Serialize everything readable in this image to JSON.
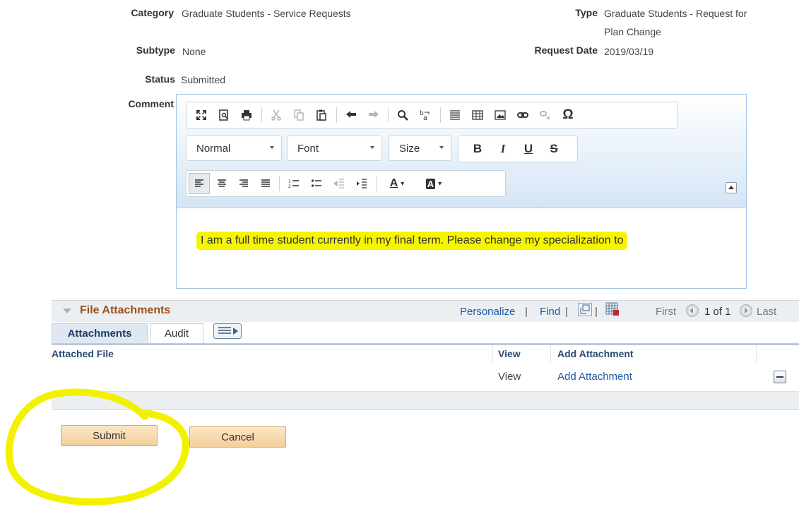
{
  "form": {
    "category_label": "Category",
    "category_value": "Graduate Students - Service Requests",
    "type_label": "Type",
    "type_value_line1": "Graduate Students - Request for",
    "type_value_line2": "Plan Change",
    "subtype_label": "Subtype",
    "subtype_value": "None",
    "request_date_label": "Request Date",
    "request_date_value": "2019/03/19",
    "status_label": "Status",
    "status_value": "Submitted",
    "comment_label": "Comment"
  },
  "editor": {
    "format_combo": "Normal",
    "font_combo": "Font",
    "size_combo": "Size",
    "bold": "B",
    "italic": "I",
    "underline": "U",
    "strike": "S",
    "omega": "Ω",
    "text_color": "A",
    "bg_color": "A",
    "comment_text": "I am a full time student currently in my final term. Please change my specialization to"
  },
  "attachments": {
    "section_title": "File Attachments",
    "personalize": "Personalize",
    "find": "Find",
    "separator": "|",
    "first": "First",
    "page_info": "1 of 1",
    "last": "Last",
    "tab_attachments": "Attachments",
    "tab_audit": "Audit",
    "col_attached_file": "Attached File",
    "col_view": "View",
    "col_add_attachment": "Add Attachment",
    "rows": [
      {
        "attached_file": "",
        "view": "View",
        "add_attachment": "Add Attachment"
      }
    ]
  },
  "buttons": {
    "submit": "Submit",
    "cancel": "Cancel"
  },
  "colors": {
    "highlight": "#f5f500",
    "link": "#1f5aa6",
    "section_title": "#9b4f1d",
    "button_fill": "#f5cf9a"
  }
}
